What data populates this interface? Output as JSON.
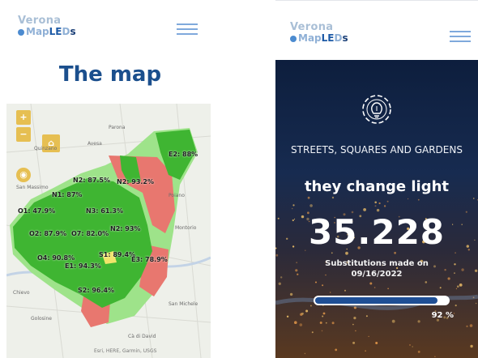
{
  "logo": {
    "line1": "Verona",
    "line2_a": "Map",
    "line2_b": "LE",
    "line2_c": "D",
    "line2_d": "s"
  },
  "left_screen": {
    "title": "The map",
    "map": {
      "zoom_in": "+",
      "zoom_out": "−",
      "attribution": "Esri, HERE, Garmin, USGS",
      "colors": {
        "complete": "#3fb532",
        "partial": "#9ee38a",
        "pending": "#e8776f",
        "highlight": "#f2e46a"
      },
      "district_labels": [
        "Parona",
        "Quinzano",
        "Avesa",
        "Poiano",
        "Montorio",
        "San Massimo",
        "Chievo",
        "Golosine",
        "San Michele",
        "Cà di David"
      ],
      "percent_labels": [
        "E2: 88%",
        "N2: 87.5%",
        "N1: 87%",
        "N2: 93.2%",
        "N3: 61.3%",
        "O1: 47.9%",
        "O2: 87.9%",
        "O7: 82.0%",
        "N2: 93%",
        "S1: 89.4%",
        "O4: 90.8%",
        "E1: 94.3%",
        "E3: 78.9%",
        "S2: 96.4%"
      ]
    },
    "menu_icon": "hamburger-icon"
  },
  "right_screen": {
    "menu_icon": "hamburger-icon",
    "hero_icon": "lightbulb-gear-icon",
    "heading_small": "STREETS, SQUARES AND GARDENS",
    "heading_large": "they change light",
    "counter": "35.228",
    "caption": "Substitutions made on 09/16/2022",
    "progress_value": 92,
    "progress_label": "92 %",
    "colors": {
      "track": "#ffffff",
      "fill": "#1f4f95"
    }
  }
}
